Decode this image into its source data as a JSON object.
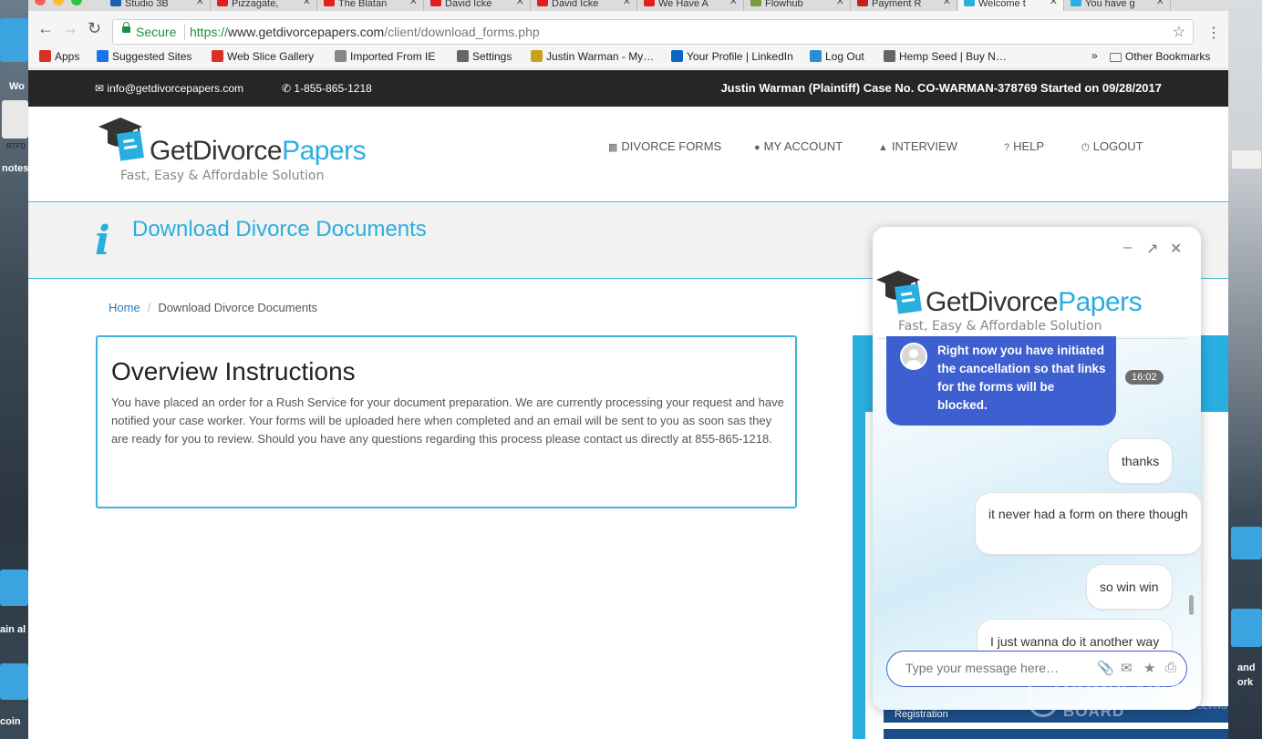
{
  "browser": {
    "tabs": [
      {
        "label": "Studio 3B",
        "color": "#1a5fb4"
      },
      {
        "label": "Pizzagate,",
        "color": "#e02020"
      },
      {
        "label": "The Blatan",
        "color": "#e02020"
      },
      {
        "label": "David Icke",
        "color": "#e02020"
      },
      {
        "label": "David Icke",
        "color": "#e02020"
      },
      {
        "label": "We Have A",
        "color": "#e02020"
      },
      {
        "label": "Flowhub",
        "color": "#7a9a3a"
      },
      {
        "label": "Payment R",
        "color": "#c5221f"
      },
      {
        "label": "Welcome t",
        "color": "#29aee0"
      },
      {
        "label": "You have g",
        "color": "#29aee0"
      }
    ],
    "secure_label": "Secure",
    "url_scheme": "https://",
    "url_host": "www.getdivorcepapers.com",
    "url_path": "/client/download_forms.php",
    "bookmarks": [
      {
        "label": "Apps",
        "color": "#d93025"
      },
      {
        "label": "Suggested Sites",
        "color": "#1a73e8"
      },
      {
        "label": "Web Slice Gallery",
        "color": "#d93025"
      },
      {
        "label": "Imported From IE",
        "color": "#888888"
      },
      {
        "label": "Settings",
        "color": "#666666"
      },
      {
        "label": "Justin Warman - My…",
        "color": "#c9a21b"
      },
      {
        "label": "Your Profile | LinkedIn",
        "color": "#0a66c2"
      },
      {
        "label": "Log Out",
        "color": "#2a8fd0"
      },
      {
        "label": "Hemp Seed | Buy N…",
        "color": "#666666"
      }
    ],
    "overflow_chevron": "»",
    "other_bookmarks": "Other Bookmarks"
  },
  "desktop": {
    "labels": [
      "Wo",
      "RTFD",
      "notes",
      "ain al",
      "coin",
      "and",
      "ork"
    ]
  },
  "site": {
    "email": "info@getdivorcepapers.com",
    "phone": "1-855-865-1218",
    "case_info": "Justin Warman (Plaintiff) Case No. CO-WARMAN-378769  Started on 09/28/2017",
    "logo_get": "Get",
    "logo_divorce": "Divorce",
    "logo_papers": "Papers",
    "tagline": "Fast, Easy & Affordable Solution",
    "nav": [
      "DIVORCE FORMS",
      "MY ACCOUNT",
      "INTERVIEW",
      "HELP",
      "LOGOUT"
    ],
    "page_title": "Download Divorce Documents",
    "breadcrumb_home": "Home",
    "breadcrumb_current": "Download Divorce Documents",
    "panel_title": "Overview Instructions",
    "panel_text": "You have placed an order for a Rush Service for your document preparation. We are currently processing your request and have notified your case worker. Your forms will be uploaded here when completed and an email will be sent to you as soon sas they are ready for you to review. Should you have any questions regarding this process please contact us directly at 855-865-1218.",
    "sidebar_button": "Registration"
  },
  "chat": {
    "agent_message": "Right now you have initiated the cancellation so that links for the forms will be blocked.",
    "agent_time": "16:02",
    "user_messages": [
      "thanks",
      "it never had a form on there though",
      "so win win",
      "I just wanna do it another way"
    ],
    "input_placeholder": "Type your message here…"
  },
  "watermark": {
    "line1": "COMPLAINTS",
    "line2": "BOARD",
    "line3": "RESOLVING SINCE 2001"
  }
}
